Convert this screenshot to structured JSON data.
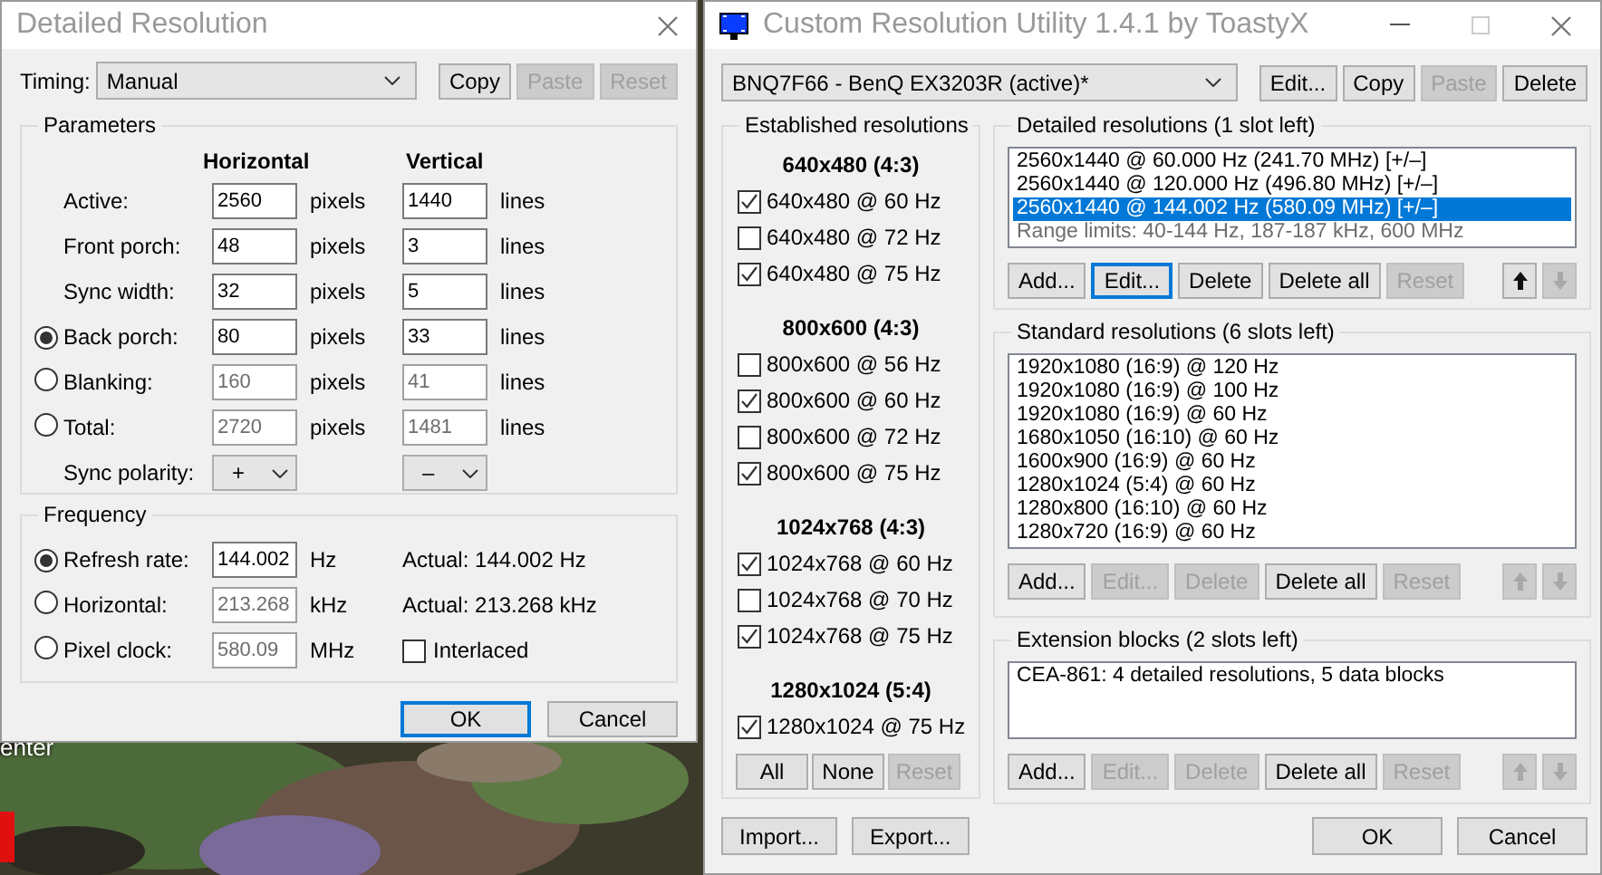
{
  "desktop": {
    "label": "enter"
  },
  "detailed_window": {
    "title": "Detailed Resolution",
    "timing": {
      "label": "Timing:",
      "value": "Manual"
    },
    "timing_buttons": [
      {
        "label": "Copy",
        "disabled": false
      },
      {
        "label": "Paste",
        "disabled": true
      },
      {
        "label": "Reset",
        "disabled": true
      }
    ],
    "parameters": {
      "title": "Parameters",
      "columns": [
        "Horizontal",
        "Vertical"
      ],
      "rows": [
        {
          "kind": "plain",
          "label": "Active:",
          "h": "2560",
          "h_unit": "pixels",
          "v": "1440",
          "v_unit": "lines",
          "disabled": false
        },
        {
          "kind": "plain",
          "label": "Front porch:",
          "h": "48",
          "h_unit": "pixels",
          "v": "3",
          "v_unit": "lines",
          "disabled": false
        },
        {
          "kind": "plain",
          "label": "Sync width:",
          "h": "32",
          "h_unit": "pixels",
          "v": "5",
          "v_unit": "lines",
          "disabled": false
        },
        {
          "kind": "radio",
          "label": "Back porch:",
          "selected": true,
          "h": "80",
          "h_unit": "pixels",
          "v": "33",
          "v_unit": "lines",
          "disabled": false
        },
        {
          "kind": "radio",
          "label": "Blanking:",
          "selected": false,
          "h": "160",
          "h_unit": "pixels",
          "v": "41",
          "v_unit": "lines",
          "disabled": true
        },
        {
          "kind": "radio",
          "label": "Total:",
          "selected": false,
          "h": "2720",
          "h_unit": "pixels",
          "v": "1481",
          "v_unit": "lines",
          "disabled": true
        }
      ],
      "sync_polarity": {
        "label": "Sync polarity:",
        "h": "+",
        "v": "–"
      }
    },
    "frequency": {
      "title": "Frequency",
      "rows": [
        {
          "kind": "actual",
          "label": "Refresh rate:",
          "selected": true,
          "value": "144.002",
          "unit": "Hz",
          "disabled": false,
          "actual": "Actual: 144.002 Hz"
        },
        {
          "kind": "actual",
          "label": "Horizontal:",
          "selected": false,
          "value": "213.268",
          "unit": "kHz",
          "disabled": true,
          "actual": "Actual: 213.268 kHz"
        },
        {
          "kind": "checkbox",
          "label": "Pixel clock:",
          "selected": false,
          "value": "580.09",
          "unit": "MHz",
          "disabled": true,
          "checkbox": {
            "label": "Interlaced",
            "checked": false
          }
        }
      ]
    },
    "buttons": [
      {
        "label": "OK",
        "focused": true
      },
      {
        "label": "Cancel",
        "focused": false
      }
    ]
  },
  "cru_window": {
    "title": "Custom Resolution Utility 1.4.1 by ToastyX",
    "display": {
      "value": "BNQ7F66 - BenQ EX3203R (active)*"
    },
    "display_buttons": [
      {
        "label": "Edit...",
        "disabled": false
      },
      {
        "label": "Copy",
        "disabled": false
      },
      {
        "label": "Paste",
        "disabled": true
      },
      {
        "label": "Delete",
        "disabled": false
      }
    ],
    "established": {
      "title": "Established resolutions",
      "groups": [
        {
          "heading": "640x480 (4:3)",
          "items": [
            {
              "label": "640x480 @ 60 Hz",
              "checked": true
            },
            {
              "label": "640x480 @ 72 Hz",
              "checked": false
            },
            {
              "label": "640x480 @ 75 Hz",
              "checked": true
            }
          ]
        },
        {
          "heading": "800x600 (4:3)",
          "items": [
            {
              "label": "800x600 @ 56 Hz",
              "checked": false
            },
            {
              "label": "800x600 @ 60 Hz",
              "checked": true
            },
            {
              "label": "800x600 @ 72 Hz",
              "checked": false
            },
            {
              "label": "800x600 @ 75 Hz",
              "checked": true
            }
          ]
        },
        {
          "heading": "1024x768 (4:3)",
          "items": [
            {
              "label": "1024x768 @ 60 Hz",
              "checked": true
            },
            {
              "label": "1024x768 @ 70 Hz",
              "checked": false
            },
            {
              "label": "1024x768 @ 75 Hz",
              "checked": true
            }
          ]
        },
        {
          "heading": "1280x1024 (5:4)",
          "items": [
            {
              "label": "1280x1024 @ 75 Hz",
              "checked": true
            }
          ]
        }
      ],
      "buttons": [
        {
          "label": "All",
          "disabled": false
        },
        {
          "label": "None",
          "disabled": false
        },
        {
          "label": "Reset",
          "disabled": true
        }
      ]
    },
    "sections": [
      {
        "title": "Detailed resolutions (1 slot left)",
        "items": [
          {
            "label": "2560x1440 @ 60.000 Hz (241.70 MHz) [+/–]",
            "selected": false,
            "disabled": false
          },
          {
            "label": "2560x1440 @ 120.000 Hz (496.80 MHz) [+/–]",
            "selected": false,
            "disabled": false
          },
          {
            "label": "2560x1440 @ 144.002 Hz (580.09 MHz) [+/–]",
            "selected": true,
            "disabled": false
          },
          {
            "label": "Range limits: 40-144 Hz, 187-187 kHz, 600 MHz",
            "selected": false,
            "disabled": true
          }
        ],
        "buttons": [
          {
            "label": "Add...",
            "disabled": false,
            "focused": false
          },
          {
            "label": "Edit...",
            "disabled": false,
            "focused": true
          },
          {
            "label": "Delete",
            "disabled": false,
            "focused": false
          },
          {
            "label": "Delete all",
            "disabled": false,
            "focused": false
          },
          {
            "label": "Reset",
            "disabled": true,
            "focused": false
          }
        ],
        "arrows": [
          {
            "kind": "up",
            "disabled": false
          },
          {
            "kind": "down",
            "disabled": true
          }
        ]
      },
      {
        "title": "Standard resolutions (6 slots left)",
        "items": [
          {
            "label": "1920x1080 (16:9) @ 120 Hz",
            "selected": false,
            "disabled": false
          },
          {
            "label": "1920x1080 (16:9) @ 100 Hz",
            "selected": false,
            "disabled": false
          },
          {
            "label": "1920x1080 (16:9) @ 60 Hz",
            "selected": false,
            "disabled": false
          },
          {
            "label": "1680x1050 (16:10) @ 60 Hz",
            "selected": false,
            "disabled": false
          },
          {
            "label": "1600x900 (16:9) @ 60 Hz",
            "selected": false,
            "disabled": false
          },
          {
            "label": "1280x1024 (5:4) @ 60 Hz",
            "selected": false,
            "disabled": false
          },
          {
            "label": "1280x800 (16:10) @ 60 Hz",
            "selected": false,
            "disabled": false
          },
          {
            "label": "1280x720 (16:9) @ 60 Hz",
            "selected": false,
            "disabled": false
          }
        ],
        "buttons": [
          {
            "label": "Add...",
            "disabled": false,
            "focused": false
          },
          {
            "label": "Edit...",
            "disabled": true,
            "focused": false
          },
          {
            "label": "Delete",
            "disabled": true,
            "focused": false
          },
          {
            "label": "Delete all",
            "disabled": false,
            "focused": false
          },
          {
            "label": "Reset",
            "disabled": true,
            "focused": false
          }
        ],
        "arrows": [
          {
            "kind": "up",
            "disabled": true
          },
          {
            "kind": "down",
            "disabled": true
          }
        ]
      },
      {
        "title": "Extension blocks (2 slots left)",
        "items": [
          {
            "label": "CEA-861: 4 detailed resolutions, 5 data blocks",
            "selected": false,
            "disabled": false
          }
        ],
        "buttons": [
          {
            "label": "Add...",
            "disabled": false,
            "focused": false
          },
          {
            "label": "Edit...",
            "disabled": true,
            "focused": false
          },
          {
            "label": "Delete",
            "disabled": true,
            "focused": false
          },
          {
            "label": "Delete all",
            "disabled": false,
            "focused": false
          },
          {
            "label": "Reset",
            "disabled": true,
            "focused": false
          }
        ],
        "arrows": [
          {
            "kind": "up",
            "disabled": true
          },
          {
            "kind": "down",
            "disabled": true
          }
        ]
      }
    ],
    "footer_buttons": [
      {
        "label": "Import..."
      },
      {
        "label": "Export..."
      }
    ],
    "buttons": [
      {
        "label": "OK",
        "focused": false
      },
      {
        "label": "Cancel",
        "focused": false
      }
    ]
  }
}
